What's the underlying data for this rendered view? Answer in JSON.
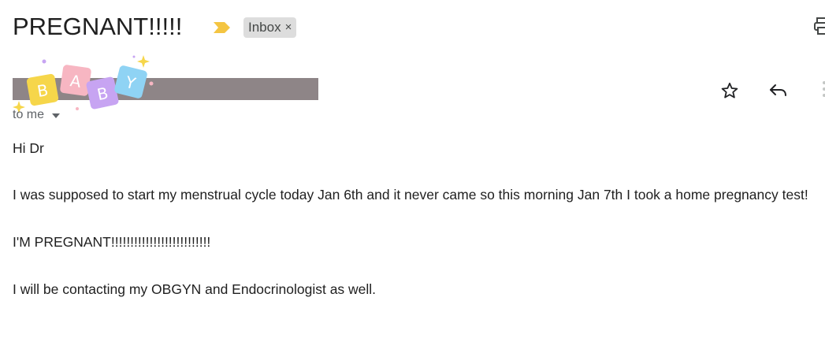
{
  "email": {
    "subject": "PREGNANT!!!!!",
    "label": "Inbox",
    "label_close": "×",
    "recipient": "to me",
    "sticker_letters": [
      "B",
      "A",
      "B",
      "Y"
    ],
    "body": {
      "greeting": "Hi Dr",
      "paragraph1": "I was supposed to start my menstrual cycle today Jan 6th and it never came so this morning Jan 7th I took a home pregnancy test!",
      "paragraph2": "I'M PREGNANT!!!!!!!!!!!!!!!!!!!!!!!!!!",
      "paragraph3": "I will be contacting my OBGYN and Endocrinologist as well."
    }
  },
  "icons": {
    "important": "important-marker-icon",
    "print": "print-icon",
    "star": "star-icon",
    "reply": "reply-icon",
    "more": "more-vert-icon",
    "recipient_dropdown": "chevron-down-icon"
  },
  "colors": {
    "important_marker": "#f4c542",
    "label_chip_bg": "#dddddd",
    "redaction": "#8e8587",
    "sticker_yellow": "#f6d64a",
    "sticker_pink": "#f7b6c2",
    "sticker_purple": "#c7a4f2",
    "sticker_blue": "#8fd3f4"
  }
}
